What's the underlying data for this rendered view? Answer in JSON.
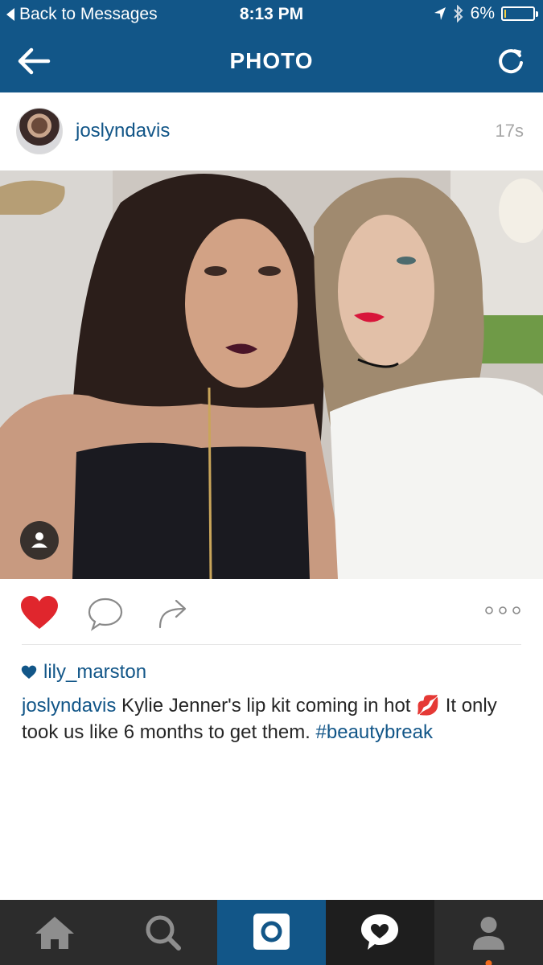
{
  "status": {
    "back_label": "Back to Messages",
    "time": "8:13 PM",
    "battery": "6%",
    "battery_level": 0.06
  },
  "nav": {
    "title": "PHOTO"
  },
  "post": {
    "username": "joslyndavis",
    "time_ago": "17s",
    "liked_by": "lily_marston",
    "caption_user": "joslyndavis",
    "caption_text": " Kylie Jenner's lip kit coming in hot 💋  It only took us like 6 months to get them. ",
    "caption_hashtag": "#beautybreak"
  },
  "colors": {
    "brand": "#125688",
    "like_red": "#e0262d",
    "tab_dark": "#2c2c2c"
  },
  "icons": {
    "back": "arrow-left-icon",
    "refresh": "refresh-icon",
    "like": "heart-icon",
    "comment": "comment-bubble-icon",
    "share": "share-arrow-icon",
    "more": "more-dots-icon",
    "tabs": [
      "home-icon",
      "search-icon",
      "camera-icon",
      "activity-heart-icon",
      "profile-icon"
    ]
  }
}
